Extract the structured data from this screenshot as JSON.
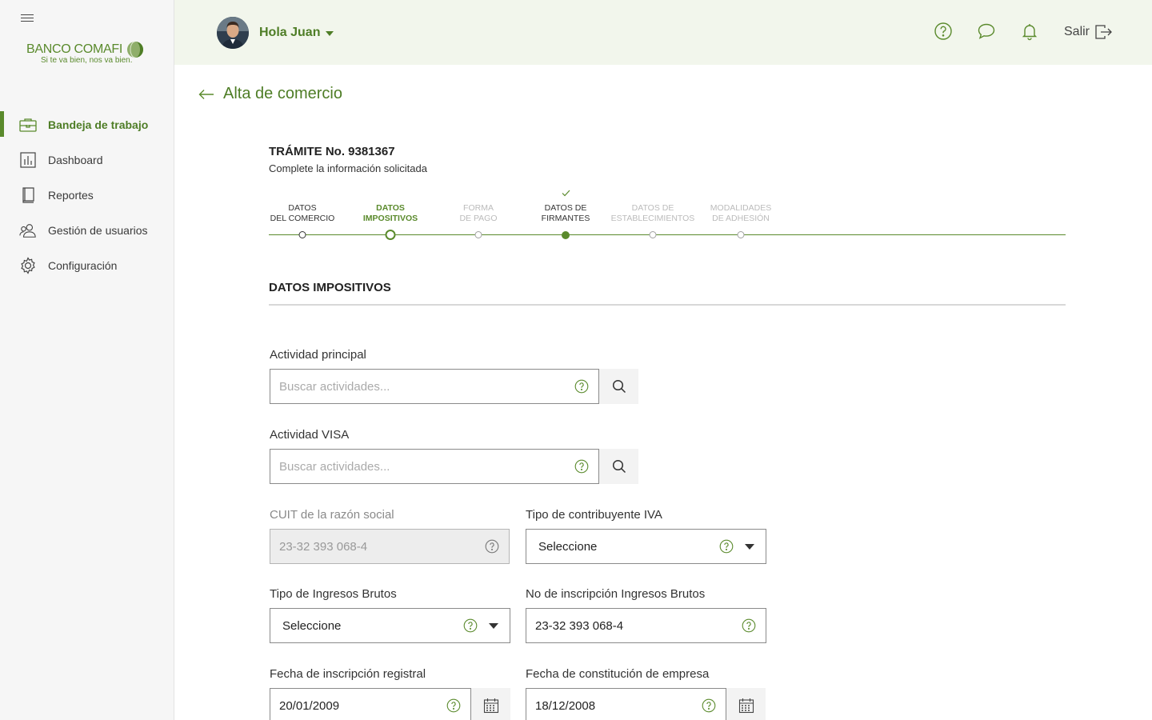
{
  "brand": {
    "name": "BANCO COMAFI",
    "tagline": "Si te va bien, nos va bien."
  },
  "sidebar": {
    "items": [
      {
        "label": "Bandeja de trabajo",
        "icon": "briefcase-icon",
        "active": true
      },
      {
        "label": "Dashboard",
        "icon": "bar-chart-icon",
        "active": false
      },
      {
        "label": "Reportes",
        "icon": "book-icon",
        "active": false
      },
      {
        "label": "Gestión de usuarios",
        "icon": "users-icon",
        "active": false
      },
      {
        "label": "Configuración",
        "icon": "gear-icon",
        "active": false
      }
    ]
  },
  "topbar": {
    "greeting": "Hola Juan",
    "logout_label": "Salir",
    "icons": [
      "help-icon",
      "chat-icon",
      "bell-icon",
      "logout-icon"
    ]
  },
  "page": {
    "title": "Alta de comercio",
    "tramite": "TRÁMITE No. 9381367",
    "subtitle": "Complete la información solicitada"
  },
  "stepper": {
    "steps": [
      {
        "line1": "DATOS",
        "line2": "DEL COMERCIO",
        "state": "done"
      },
      {
        "line1": "DATOS",
        "line2": "IMPOSITIVOS",
        "state": "current"
      },
      {
        "line1": "FORMA",
        "line2": "DE PAGO",
        "state": "pending"
      },
      {
        "line1": "DATOS DE",
        "line2": "FIRMANTES",
        "state": "completed-check"
      },
      {
        "line1": "DATOS DE",
        "line2": "ESTABLECIMIENTOS",
        "state": "pending"
      },
      {
        "line1": "MODALIDADES",
        "line2": "DE ADHESIÓN",
        "state": "pending"
      }
    ]
  },
  "section": {
    "title": "DATOS IMPOSITIVOS"
  },
  "form": {
    "actividad_principal": {
      "label": "Actividad principal",
      "placeholder": "Buscar actividades..."
    },
    "actividad_visa": {
      "label": "Actividad VISA",
      "placeholder": "Buscar actividades..."
    },
    "cuit": {
      "label": "CUIT de la razón social",
      "value": "23-32 393 068-4"
    },
    "tipo_contribuyente": {
      "label": "Tipo de contribuyente IVA",
      "value": "Seleccione"
    },
    "tipo_ingresos": {
      "label": "Tipo de Ingresos Brutos",
      "value": "Seleccione"
    },
    "no_inscripcion": {
      "label": "No de inscripción Ingresos Brutos",
      "value": "23-32 393 068-4"
    },
    "fecha_inscripcion": {
      "label": "Fecha de inscripción registral",
      "value": "20/01/2009"
    },
    "fecha_constitucion": {
      "label": "Fecha de constitución de empresa",
      "value": "18/12/2008"
    }
  },
  "colors": {
    "accent": "#5a8a2c",
    "topbar_bg": "#f2f6ec",
    "sidebar_bg": "#f6f6f6"
  }
}
